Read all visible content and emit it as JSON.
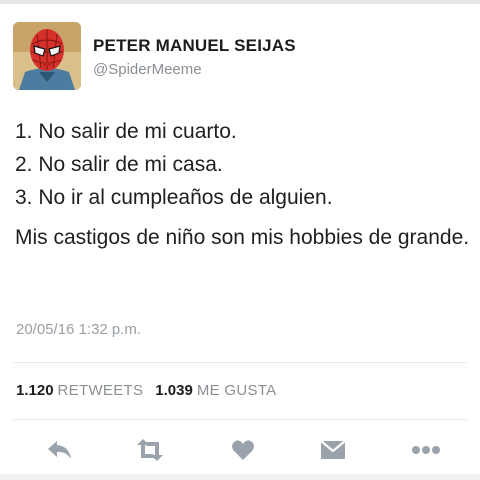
{
  "tweet": {
    "display_name": "PETER MANUEL SEIJAS",
    "handle": "@SpiderMeeme",
    "lines": [
      "1. No salir de mi cuarto.",
      "2. No salir de mi casa.",
      "3. No ir al cumpleaños de alguien."
    ],
    "paragraph": "Mis castigos de niño son mis hobbies de grande.",
    "timestamp": "20/05/16 1:32 p.m."
  },
  "stats": {
    "retweets_count": "1.120",
    "retweets_label": "RETWEETS",
    "likes_count": "1.039",
    "likes_label": "ME GUSTA"
  },
  "actions": [
    "reply-icon",
    "retweet-icon",
    "like-heart-icon",
    "direct-message-icon",
    "more-options-icon"
  ],
  "colors": {
    "icon": "#9aa3ab",
    "muted_text": "#8a8f94",
    "text": "#1c1c1c"
  }
}
